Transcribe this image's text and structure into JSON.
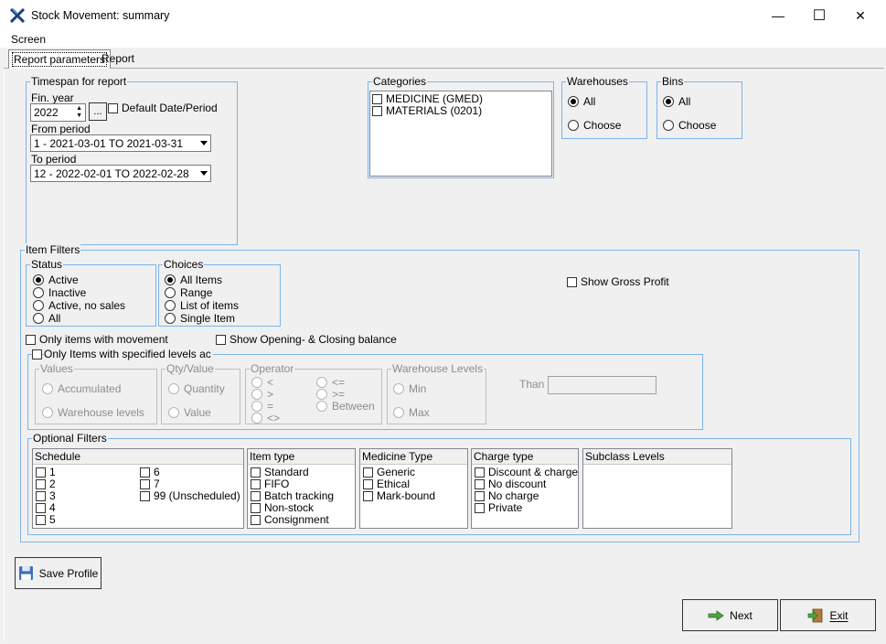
{
  "window": {
    "title": "Stock Movement: summary",
    "minimize": "—",
    "maximize": "☐",
    "close": "✕"
  },
  "menu": {
    "screen": "Screen"
  },
  "tabs": {
    "params": "Report parameters",
    "report": "Report"
  },
  "timespan": {
    "legend": "Timespan for report",
    "fin_year_label": "Fin. year",
    "fin_year": "2022",
    "browse": "...",
    "default_label": "Default Date/Period",
    "from_label": "From period",
    "from_value": "1  - 2021-03-01 TO 2021-03-31",
    "to_label": "To period",
    "to_value": "12 - 2022-02-01 TO 2022-02-28"
  },
  "categories": {
    "legend": "Categories",
    "items": [
      "MEDICINE  (GMED)",
      "MATERIALS  (0201)"
    ]
  },
  "warehouses": {
    "legend": "Warehouses",
    "all": "All",
    "choose": "Choose"
  },
  "bins": {
    "legend": "Bins",
    "all": "All",
    "choose": "Choose"
  },
  "item_filters": {
    "legend": "Item Filters",
    "show_gross_profit": "Show Gross Profit",
    "only_movement": "Only items with movement",
    "show_balance": "Show Opening- & Closing balance",
    "only_levels": "Only Items with specified levels ac"
  },
  "status": {
    "legend": "Status",
    "options": [
      "Active",
      "Inactive",
      "Active, no sales",
      "All"
    ]
  },
  "choices": {
    "legend": "Choices",
    "options": [
      "All Items",
      "Range",
      "List of items",
      "Single Item"
    ]
  },
  "values": {
    "legend": "Values",
    "accumulated": "Accumulated",
    "warehouse_levels": "Warehouse levels"
  },
  "qty": {
    "legend": "Qty/Value",
    "quantity": "Quantity",
    "value": "Value"
  },
  "operator": {
    "legend": "Operator",
    "lt": "<",
    "gt": ">",
    "eq": "=",
    "ne": "<>",
    "le": "<=",
    "ge": ">=",
    "between": "Between"
  },
  "wh_levels": {
    "legend": "Warehouse Levels",
    "min": "Min",
    "max": "Max",
    "than": "Than"
  },
  "optional": {
    "legend": "Optional Filters",
    "schedule": {
      "header": "Schedule",
      "col1": [
        "1",
        "2",
        "3",
        "4",
        "5"
      ],
      "col2": [
        "6",
        "7",
        "99 (Unscheduled)"
      ]
    },
    "item_type": {
      "header": "Item type",
      "items": [
        "Standard",
        "FIFO",
        "Batch tracking",
        "Non-stock",
        "Consignment"
      ]
    },
    "medicine_type": {
      "header": "Medicine Type",
      "items": [
        "Generic",
        "Ethical",
        "Mark-bound"
      ]
    },
    "charge_type": {
      "header": "Charge type",
      "items": [
        "Discount & charge",
        "No discount",
        "No charge",
        "Private"
      ]
    },
    "subclass": {
      "header": "Subclass Levels"
    }
  },
  "buttons": {
    "save_profile": "Save Profile",
    "next": "Next",
    "exit": "Exit"
  },
  "colors": {
    "group_border": "#7eb4ea",
    "window_bg": "#f0f0f0"
  }
}
